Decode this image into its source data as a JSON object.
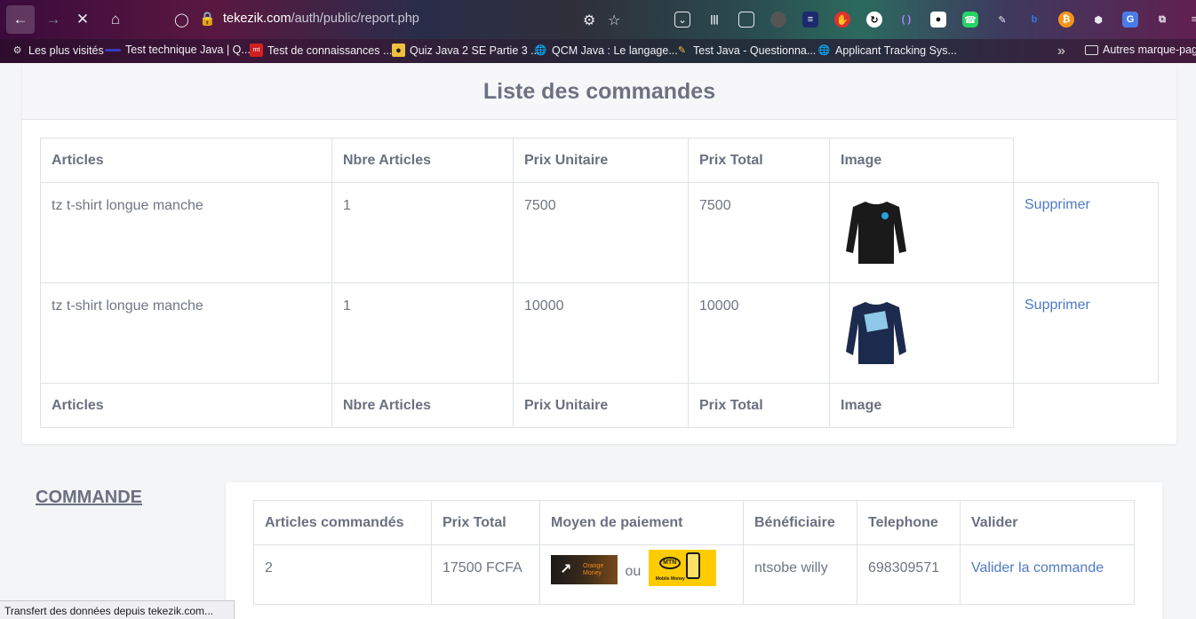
{
  "browser": {
    "url_host": "tekezik.com",
    "url_path": "/auth/public/report.php",
    "status_text": "Transfert des données depuis tekezik.com...",
    "bookmarks": [
      "Les plus visités",
      "Test technique Java | Q...",
      "Test de connaissances ...",
      "Quiz Java 2 SE Partie 3 ...",
      "QCM Java : Le langage...",
      "Test Java - Questionna...",
      "Applicant Tracking Sys...",
      "Autres marque-pages"
    ],
    "extension_icons": [
      "pocket-icon",
      "library-icon",
      "reader-icon",
      "avatar-icon",
      "list-icon",
      "red-ext-icon",
      "sync-icon",
      "brackets-icon",
      "lock-ext-icon",
      "whatsapp-icon",
      "pen-icon",
      "bing-icon",
      "bitcoin-icon",
      "shield-ext-icon",
      "translate-icon",
      "extensions-icon",
      "menu-icon"
    ]
  },
  "orders": {
    "title": "Liste des commandes",
    "headers": [
      "Articles",
      "Nbre Articles",
      "Prix Unitaire",
      "Prix Total",
      "Image"
    ],
    "rows": [
      {
        "article": "tz t-shirt longue manche",
        "qty": "1",
        "unit_price": "7500",
        "total": "7500",
        "image": "black-longsleeve-shirt",
        "action": "Supprimer"
      },
      {
        "article": "tz t-shirt longue manche",
        "qty": "1",
        "unit_price": "10000",
        "total": "10000",
        "image": "navy-sweatshirt",
        "action": "Supprimer"
      }
    ]
  },
  "commande": {
    "title": "COMMANDE",
    "headers": [
      "Articles commandés",
      "Prix Total",
      "Moyen de paiement",
      "Bénéficiaire",
      "Telephone",
      "Valider"
    ],
    "row": {
      "count": "2",
      "total": "17500 FCFA",
      "payment_or": "ou",
      "orange_money_label": "Orange Money",
      "mtn_label": "MTN",
      "mtn_sub": "Mobile Money",
      "beneficiary": "ntsobe willy",
      "phone": "698309571",
      "action": "Valider la commande"
    }
  }
}
